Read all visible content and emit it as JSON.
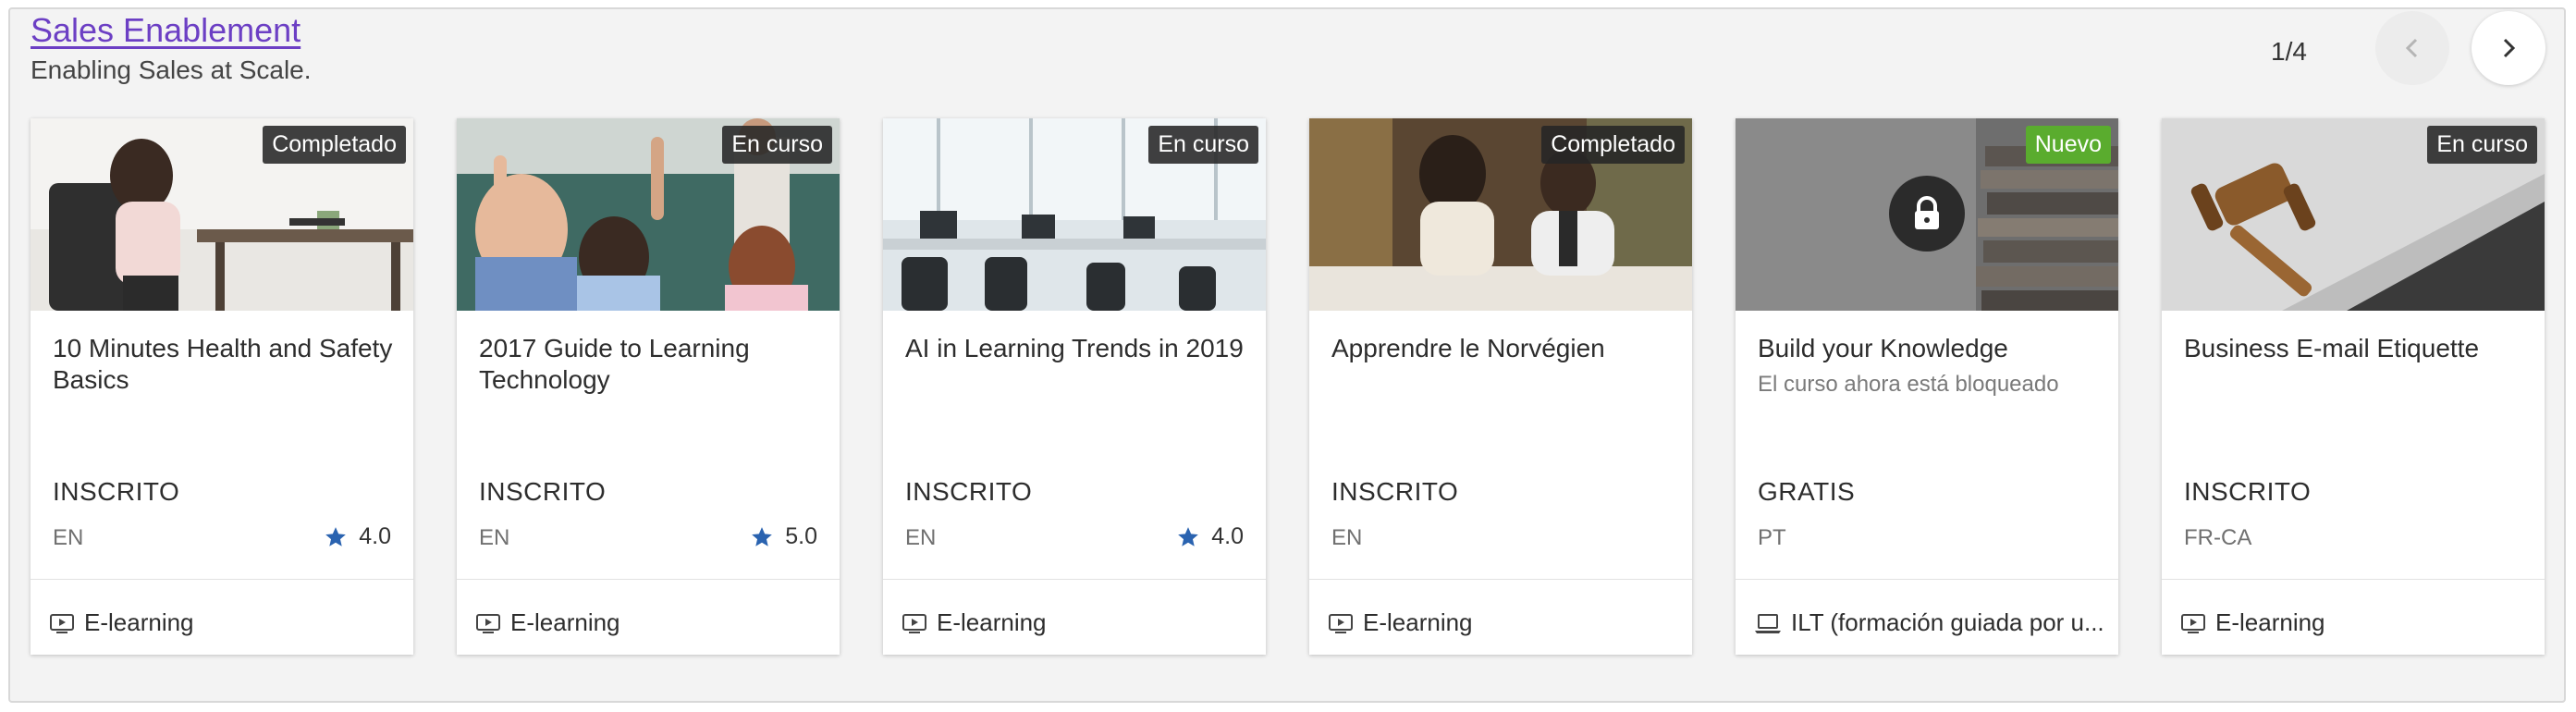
{
  "section": {
    "title": "Sales Enablement",
    "subtitle": "Enabling Sales at Scale.",
    "pager": "1/4"
  },
  "colors": {
    "title_link": "#6c3fc4",
    "star": "#2a63b0",
    "badge_dark": "#262626",
    "badge_new": "#5aac2e"
  },
  "cards": [
    {
      "badge": "Completado",
      "title": "10 Minutes Health and Safety Basics",
      "subtitle": "",
      "status": "INSCRITO",
      "language": "EN",
      "rating": "4.0",
      "type": "E-learning",
      "type_icon": "video-play-icon"
    },
    {
      "badge": "En curso",
      "title": "2017 Guide to Learning Technology",
      "subtitle": "",
      "status": "INSCRITO",
      "language": "EN",
      "rating": "5.0",
      "type": "E-learning",
      "type_icon": "video-play-icon"
    },
    {
      "badge": "En curso",
      "title": "AI in Learning Trends in 2019",
      "subtitle": "",
      "status": "INSCRITO",
      "language": "EN",
      "rating": "4.0",
      "type": "E-learning",
      "type_icon": "video-play-icon"
    },
    {
      "badge": "Completado",
      "title": "Apprendre le Norvégien",
      "subtitle": "",
      "status": "INSCRITO",
      "language": "EN",
      "rating": "",
      "type": "E-learning",
      "type_icon": "video-play-icon"
    },
    {
      "badge": "Nuevo",
      "title": "Build your Knowledge",
      "subtitle": "El curso ahora está bloqueado",
      "status": "GRATIS",
      "language": "PT",
      "rating": "",
      "type": "ILT (formación guiada por u...",
      "type_icon": "laptop-icon"
    },
    {
      "badge": "En curso",
      "title": "Business E-mail Etiquette",
      "subtitle": "",
      "status": "INSCRITO",
      "language": "FR-CA",
      "rating": "",
      "type": "E-learning",
      "type_icon": "video-play-icon"
    }
  ]
}
